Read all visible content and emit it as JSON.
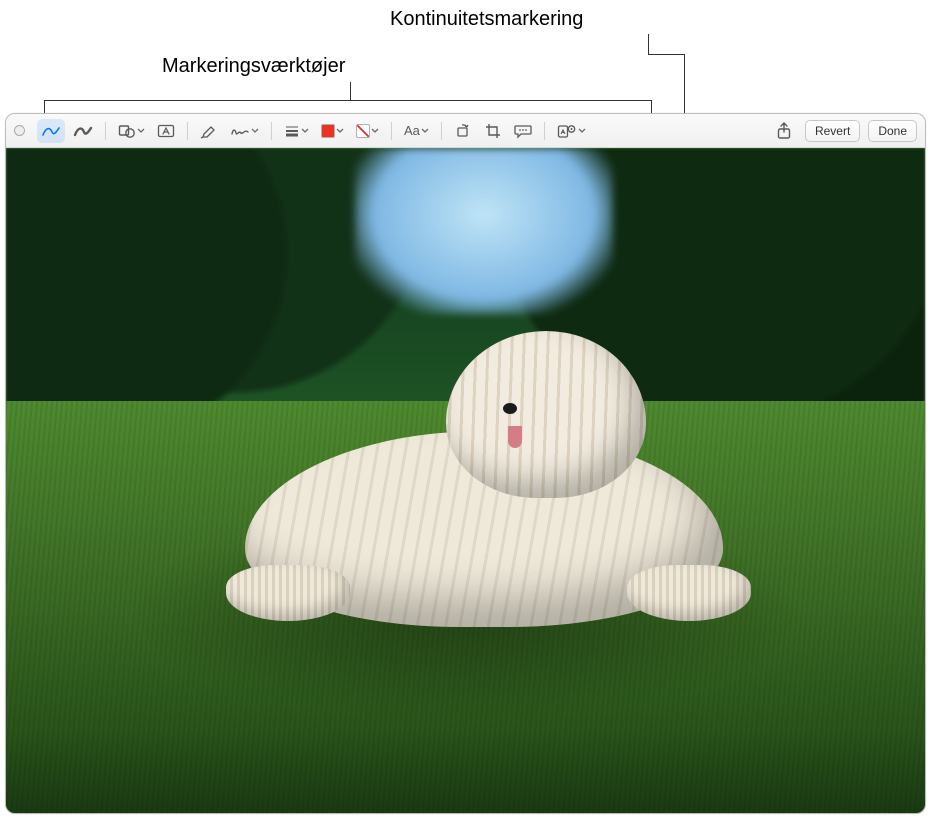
{
  "callouts": {
    "markup_tools": "Markeringsværktøjer",
    "continuity_markup": "Kontinuitetsmarkering"
  },
  "toolbar": {
    "revert_label": "Revert",
    "done_label": "Done",
    "text_style_label": "Aa",
    "accent_color": "#007aff",
    "fill_color": "#ea3323"
  },
  "icons": {
    "sketch": "sketch-icon",
    "draw": "draw-icon",
    "shapes": "shapes-icon",
    "textbox": "textbox-icon",
    "highlight": "highlight-icon",
    "sign": "sign-icon",
    "line_style": "line-style-icon",
    "fill_color": "fill-color-icon",
    "stroke_color": "stroke-color-icon",
    "text_style": "text-style-icon",
    "rotate": "rotate-icon",
    "crop": "crop-icon",
    "describe": "describe-icon",
    "annotate_device": "annotate-device-icon",
    "share": "share-icon"
  },
  "image": {
    "subject": "Komondor dog lying on grass",
    "scene": "grass lawn with trees and blue sky"
  }
}
